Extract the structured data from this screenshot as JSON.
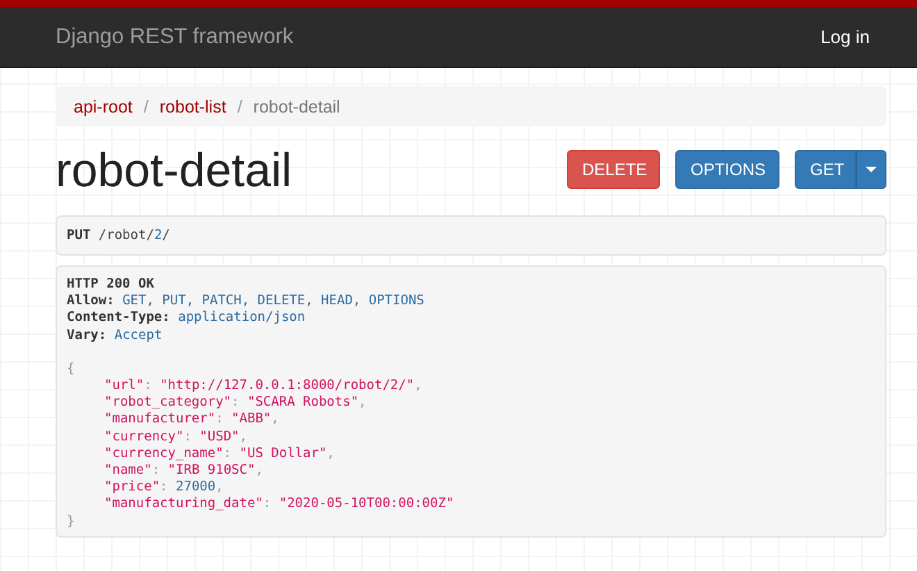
{
  "navbar": {
    "brand": "Django REST framework",
    "login": "Log in"
  },
  "breadcrumbs": [
    {
      "label": "api-root",
      "selected": false
    },
    {
      "label": "robot-list",
      "selected": false
    },
    {
      "label": "robot-detail",
      "selected": true
    }
  ],
  "separator": "/",
  "title": "robot-detail",
  "buttons": [
    {
      "label": "DELETE",
      "kind": "danger"
    },
    {
      "label": "OPTIONS",
      "kind": "primary"
    },
    {
      "label": "GET",
      "kind": "split"
    }
  ],
  "request": [
    {
      "text": "PUT",
      "kind": "method"
    },
    {
      "text": " /robot/",
      "kind": "plain"
    },
    {
      "text": "2",
      "kind": "literal"
    },
    {
      "text": "/",
      "kind": "plain"
    }
  ],
  "response": {
    "status": "HTTP 200 OK",
    "headers": [
      {
        "name": "Allow:",
        "value": "GET, PUT, PATCH, DELETE, HEAD, OPTIONS"
      },
      {
        "name": "Content-Type:",
        "value": "application/json"
      },
      {
        "name": "Vary:",
        "value": "Accept"
      }
    ],
    "open": "{",
    "lines": [
      [
        {
          "text": "\"url\"",
          "kind": "string"
        },
        {
          "text": ": ",
          "kind": "punct"
        },
        {
          "text": "\"http://127.0.0.1:8000/robot/2/\"",
          "kind": "string"
        },
        {
          "text": ",",
          "kind": "punct"
        }
      ],
      [
        {
          "text": "\"robot_category\"",
          "kind": "string"
        },
        {
          "text": ": ",
          "kind": "punct"
        },
        {
          "text": "\"SCARA Robots\"",
          "kind": "string"
        },
        {
          "text": ",",
          "kind": "punct"
        }
      ],
      [
        {
          "text": "\"manufacturer\"",
          "kind": "string"
        },
        {
          "text": ": ",
          "kind": "punct"
        },
        {
          "text": "\"ABB\"",
          "kind": "string"
        },
        {
          "text": ",",
          "kind": "punct"
        }
      ],
      [
        {
          "text": "\"currency\"",
          "kind": "string"
        },
        {
          "text": ": ",
          "kind": "punct"
        },
        {
          "text": "\"USD\"",
          "kind": "string"
        },
        {
          "text": ",",
          "kind": "punct"
        }
      ],
      [
        {
          "text": "\"currency_name\"",
          "kind": "string"
        },
        {
          "text": ": ",
          "kind": "punct"
        },
        {
          "text": "\"US Dollar\"",
          "kind": "string"
        },
        {
          "text": ",",
          "kind": "punct"
        }
      ],
      [
        {
          "text": "\"name\"",
          "kind": "string"
        },
        {
          "text": ": ",
          "kind": "punct"
        },
        {
          "text": "\"IRB 910SC\"",
          "kind": "string"
        },
        {
          "text": ",",
          "kind": "punct"
        }
      ],
      [
        {
          "text": "\"price\"",
          "kind": "string"
        },
        {
          "text": ": ",
          "kind": "punct"
        },
        {
          "text": "27000",
          "kind": "literal"
        },
        {
          "text": ",",
          "kind": "punct"
        }
      ],
      [
        {
          "text": "\"manufacturing_date\"",
          "kind": "string"
        },
        {
          "text": ": ",
          "kind": "punct"
        },
        {
          "text": "\"2020-05-10T00:00:00Z\"",
          "kind": "string"
        }
      ]
    ],
    "close": "}"
  }
}
